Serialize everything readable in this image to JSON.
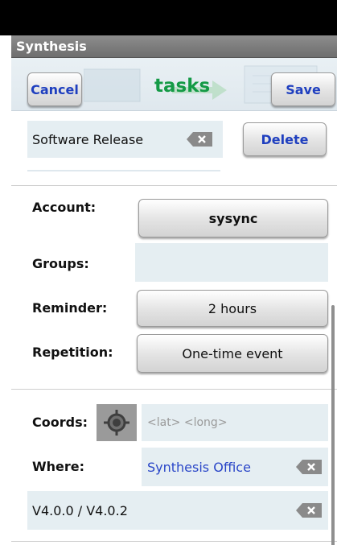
{
  "app": {
    "title": "Synthesis"
  },
  "header": {
    "cancel_label": "Cancel",
    "title": "tasks",
    "save_label": "Save"
  },
  "item": {
    "name_value": "Software Release",
    "delete_label": "Delete"
  },
  "form": {
    "account_label": "Account:",
    "account_value": "sysync",
    "groups_label": "Groups:",
    "groups_value": "",
    "reminder_label": "Reminder:",
    "reminder_value": "2 hours",
    "repetition_label": "Repetition:",
    "repetition_value": "One-time event",
    "coords_label": "Coords:",
    "coords_placeholder": "<lat>  <long>",
    "where_label": "Where:",
    "where_value": "Synthesis Office",
    "version_value": "V4.0.0 / V4.0.2"
  },
  "icons": {
    "locate": "locate-icon",
    "clear": "clear-text-icon"
  },
  "colors": {
    "title_green": "#149a46",
    "button_blue": "#1f3fbf",
    "link_blue": "#2a46c8",
    "field_bg": "#e5eef2"
  }
}
